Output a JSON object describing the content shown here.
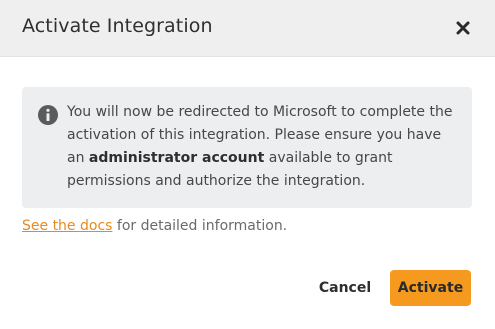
{
  "dialog": {
    "title": "Activate Integration",
    "close_icon": "close-icon"
  },
  "info": {
    "icon": "info-icon",
    "text_before": "You will now be redirected to Microsoft to complete the activation of this integration. Please ensure you have an ",
    "text_bold": "administrator account",
    "text_after": " available to grant permissions and authorize the integration."
  },
  "docs": {
    "link_label": "See the docs",
    "suffix": " for detailed information."
  },
  "actions": {
    "cancel_label": "Cancel",
    "activate_label": "Activate"
  },
  "colors": {
    "accent": "#f59a1f",
    "link": "#e8891f",
    "header_bg": "#efefef",
    "info_bg": "#eceef0"
  }
}
